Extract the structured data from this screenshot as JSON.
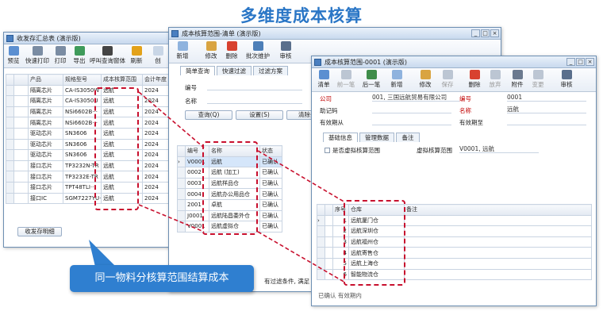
{
  "title": "多维度成本核算",
  "callout": "同一物料分核算范围结算成本",
  "win1": {
    "title": "收发存汇总表 (演示版)",
    "toolbar": [
      "预览",
      "快速打印",
      "打印",
      "导出",
      "呼叫查询窗体",
      "刷新",
      "创"
    ],
    "headers": [
      "产品",
      "规格型号",
      "成本核算范围",
      "会计年度"
    ],
    "rows": [
      [
        "隔离芯片",
        "CA-IS3050W",
        "远航",
        "2024"
      ],
      [
        "隔离芯片",
        "CA-IS3050U",
        "远航",
        "2024"
      ],
      [
        "隔离芯片",
        "NSi6602B···",
        "远航",
        "2024"
      ],
      [
        "隔离芯片",
        "NSi6602B···",
        "远航",
        "2024"
      ],
      [
        "驱动芯片",
        "SN3606",
        "远航",
        "2024"
      ],
      [
        "驱动芯片",
        "SN3606",
        "远航",
        "2024"
      ],
      [
        "驱动芯片",
        "SN3606",
        "远航",
        "2024"
      ],
      [
        "接口芯片",
        "TP3232N-TR",
        "远航",
        "2024"
      ],
      [
        "接口芯片",
        "TP3232E-TR",
        "远航",
        "2024"
      ],
      [
        "接口芯片",
        "TPT48TLI···",
        "远航",
        "2024"
      ],
      [
        "接口IC",
        "SGM7227YU···",
        "远航",
        "2024"
      ]
    ],
    "detail_btn": "收发存明细"
  },
  "win2": {
    "title": "成本核算范围-清单 (演示版)",
    "toolbar": [
      "新增",
      "修改",
      "删除",
      "批次维护",
      "审核"
    ],
    "tabs": [
      "简单查询",
      "快速过滤",
      "过滤方案"
    ],
    "labels": {
      "code": "编号",
      "name": "名称"
    },
    "buttons": {
      "query": "查询(Q)",
      "settings": "设置(S)",
      "clear": "清除条件"
    },
    "headers": [
      "编号",
      "名称",
      "状态"
    ],
    "rows": [
      [
        "V0001",
        "远航",
        "已确认"
      ],
      [
        "0002",
        "远航 (加工)",
        "已确认"
      ],
      [
        "0003",
        "远航样品仓",
        "已确认"
      ],
      [
        "0004",
        "远航办公用品仓",
        "已确认"
      ],
      [
        "2001",
        "卓航",
        "已确认"
      ],
      [
        "J0001",
        "远航陆昌委外仓",
        "已确认"
      ],
      [
        "V0001",
        "远航虚拟仓",
        "已确认"
      ]
    ],
    "footer": "有过滤条件, 满足"
  },
  "win3": {
    "title": "成本核算范围-0001 (演示版)",
    "toolbar": [
      "清单",
      "前一笔",
      "后一笔",
      "新增",
      "修改",
      "保存",
      "删除",
      "放弃",
      "附件",
      "变更",
      "审核"
    ],
    "fields": {
      "company_label": "公司",
      "company_value": "001, 三国远航贸易有限公司",
      "code_label": "编号",
      "code_value": "0001",
      "memo_label": "助记码",
      "name_label": "名称",
      "name_value": "远航",
      "from_label": "有效期从",
      "to_label": "有效期至"
    },
    "tabs": [
      "基础信息",
      "管理数据",
      "备注"
    ],
    "checkbox_label": "是否虚拟核算范围",
    "virtual_label": "虚拟核算范围",
    "virtual_value": "V0001, 远航",
    "headers": [
      "序号",
      "仓库",
      "备注"
    ],
    "rows": [
      [
        "1",
        "远航厦门仓"
      ],
      [
        "2",
        "远航深圳仓"
      ],
      [
        "3",
        "远航福州仓"
      ],
      [
        "4",
        "远航寄售仓"
      ],
      [
        "5",
        "远航上海仓"
      ],
      [
        "6",
        "智能物流仓"
      ]
    ],
    "status": "已确认 有效期内"
  }
}
